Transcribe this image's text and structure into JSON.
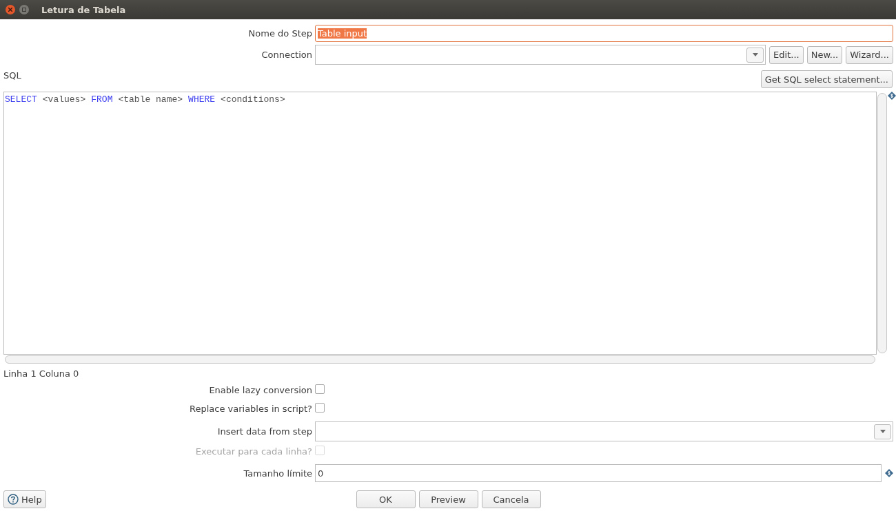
{
  "window": {
    "title": "Letura de Tabela"
  },
  "step_name": {
    "label": "Nome do Step",
    "value": "Table input",
    "selected": true
  },
  "connection": {
    "label": "Connection",
    "buttons": [
      "Edit...",
      "New...",
      "Wizard..."
    ]
  },
  "sql": {
    "label": "SQL",
    "get_button": "Get SQL select statement...",
    "tokens": [
      {
        "kind": "keyword",
        "text": "SELECT"
      },
      {
        "kind": "plain",
        "text": "<values>"
      },
      {
        "kind": "keyword",
        "text": "FROM"
      },
      {
        "kind": "plain",
        "text": "<table name>"
      },
      {
        "kind": "keyword",
        "text": "WHERE"
      },
      {
        "kind": "plain",
        "text": "<conditions>"
      }
    ]
  },
  "status": "Linha 1 Coluna 0",
  "options": [
    {
      "kind": "checkbox",
      "label": "Enable lazy conversion",
      "checked": false,
      "disabled": false
    },
    {
      "kind": "checkbox",
      "label": "Replace variables in script?",
      "checked": false,
      "disabled": false
    },
    {
      "kind": "select",
      "label": "Insert data from step",
      "disabled": false
    },
    {
      "kind": "checkbox",
      "label": "Executar para cada linha?",
      "checked": false,
      "disabled": true
    },
    {
      "kind": "text",
      "label": "Tamanho límite",
      "value": "0",
      "disabled": false
    }
  ],
  "footer": {
    "help": "Help",
    "buttons": [
      "OK",
      "Preview",
      "Cancela"
    ]
  }
}
